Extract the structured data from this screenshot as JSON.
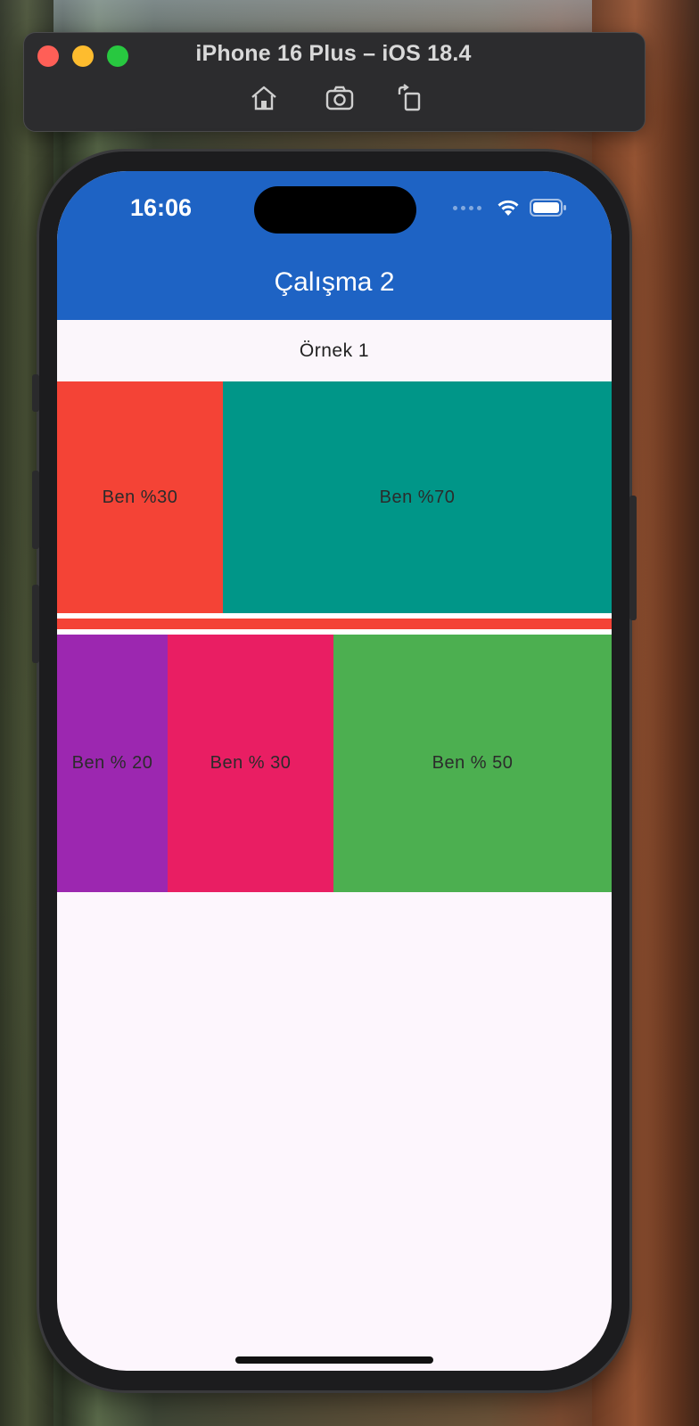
{
  "simulator": {
    "title": "iPhone 16 Plus – iOS 18.4",
    "tools": [
      "home-icon",
      "screenshot-icon",
      "rotate-icon"
    ]
  },
  "status_bar": {
    "time": "16:06"
  },
  "app_bar": {
    "title": "Çalışma 2",
    "color": "#1e63c4"
  },
  "content": {
    "header": "Örnek 1",
    "row1": [
      {
        "label": "Ben %30",
        "color": "#f44336",
        "flex": 30
      },
      {
        "label": "Ben %70",
        "color": "#009688",
        "flex": 70
      }
    ],
    "divider_color": "#f44336",
    "row2": [
      {
        "label": "Ben % 20",
        "color": "#9c27b0",
        "flex": 20
      },
      {
        "label": "Ben % 30",
        "color": "#e91e63",
        "flex": 30
      },
      {
        "label": "Ben % 50",
        "color": "#4caf50",
        "flex": 50
      }
    ]
  }
}
